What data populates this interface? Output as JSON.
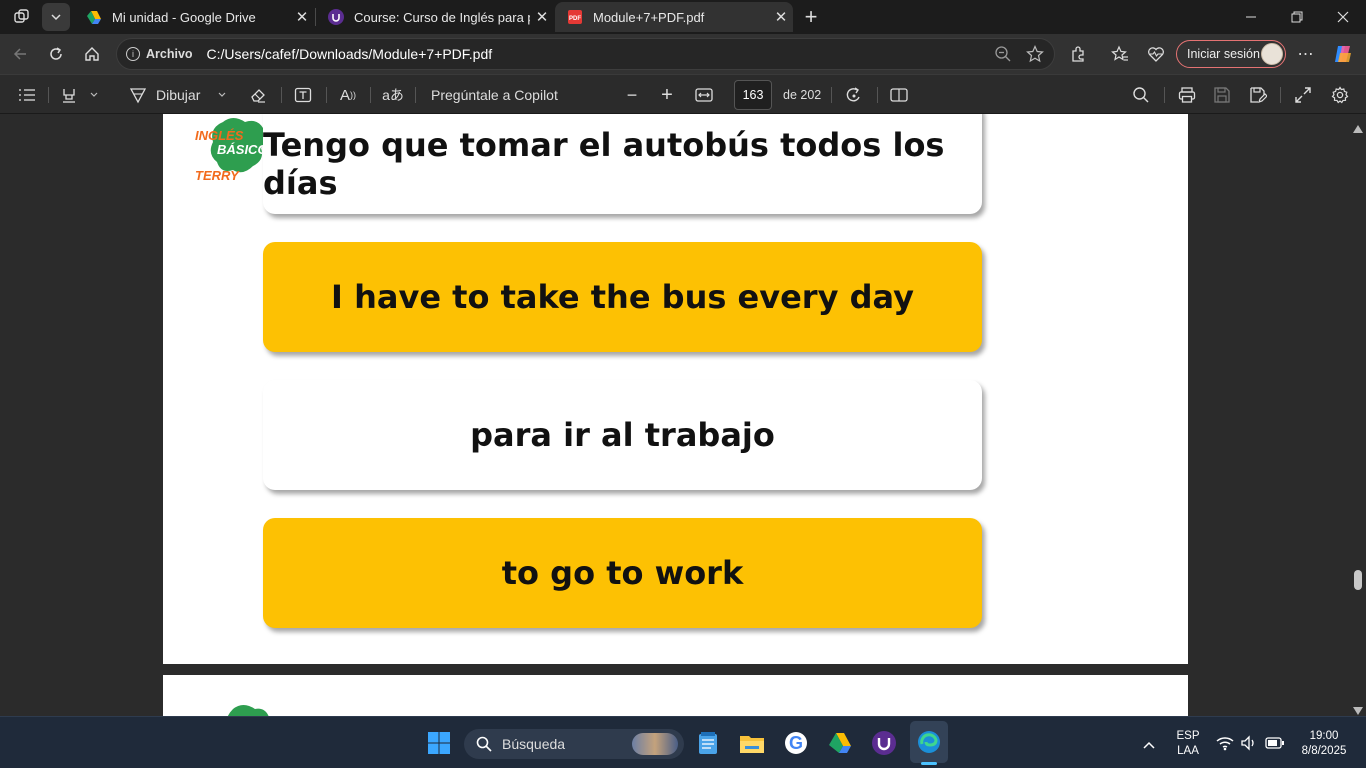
{
  "tabs": [
    {
      "title": "Mi unidad - Google Drive",
      "icon": "google-drive-icon",
      "active": false
    },
    {
      "title": "Course: Curso de Inglés para principiantes",
      "icon": "udemy-icon",
      "active": false
    },
    {
      "title": "Module+7+PDF.pdf",
      "icon": "pdf-icon",
      "active": true
    }
  ],
  "address": {
    "site_label": "Archivo",
    "url": "C:/Users/cafef/Downloads/Module+7+PDF.pdf",
    "signin_label": "Iniciar sesión"
  },
  "pdf_toolbar": {
    "draw_label": "Dibujar",
    "copilot_label": "Pregúntale a Copilot",
    "page_current": "163",
    "page_total_label": "de 202",
    "translate_glyph": "あ"
  },
  "document": {
    "logo_text": [
      "INGLÉS",
      "BÁSICO",
      "TERRY"
    ],
    "cards": [
      {
        "text": "Tengo que tomar el autobús todos los días",
        "style": "white"
      },
      {
        "text": "I have to take the bus every day",
        "style": "yellow"
      },
      {
        "text": "para ir al trabajo",
        "style": "white"
      },
      {
        "text": "to go to work",
        "style": "yellow"
      }
    ]
  },
  "taskbar": {
    "search_placeholder": "Búsqueda",
    "apps": [
      "start-icon",
      "notepad-icon",
      "file-explorer-icon",
      "google-chrome-icon",
      "google-drive-icon",
      "udemy-icon",
      "edge-icon"
    ],
    "lang_top": "ESP",
    "lang_bottom": "LAA",
    "time": "19:00",
    "date": "8/8/2025"
  },
  "colors": {
    "accent_yellow": "#fdc103",
    "logo_green": "#2e9e4f",
    "logo_orange": "#f26b1d"
  }
}
